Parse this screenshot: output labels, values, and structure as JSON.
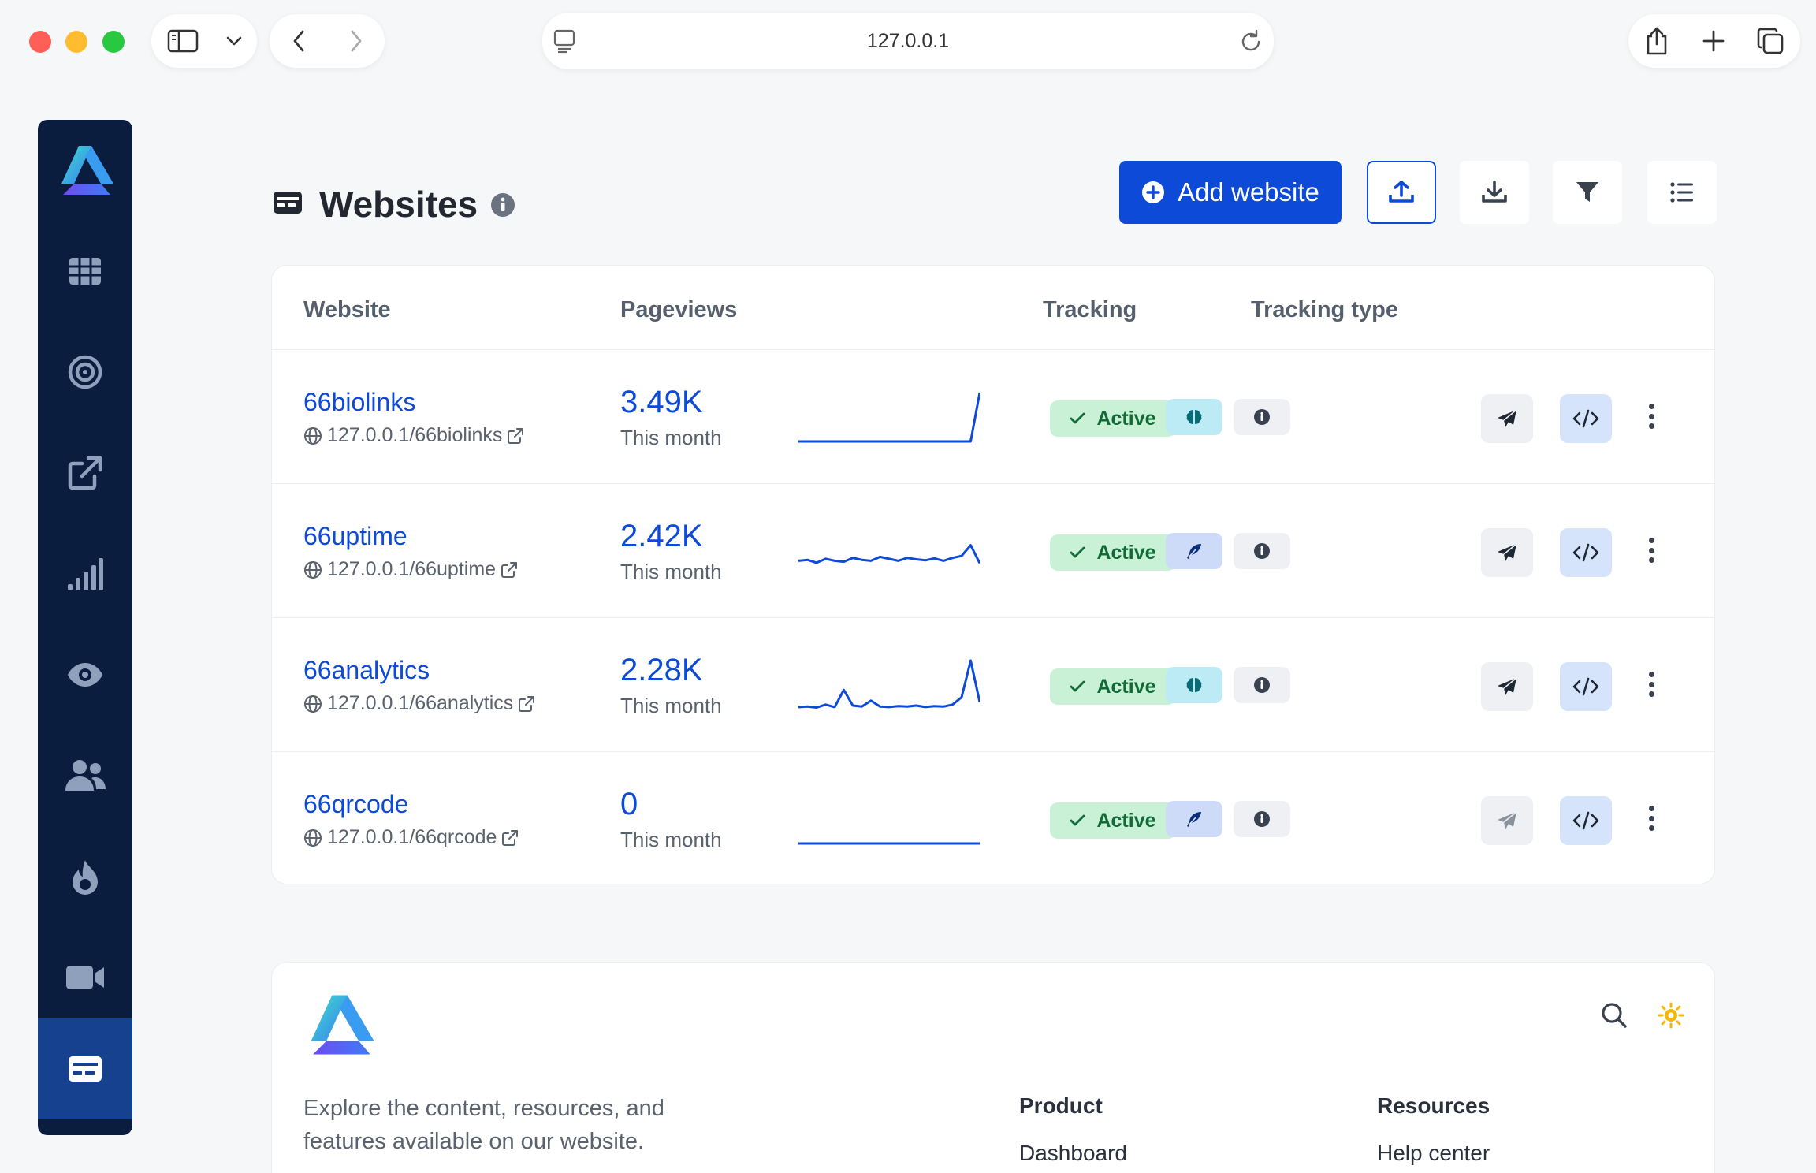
{
  "browser": {
    "url": "127.0.0.1"
  },
  "page": {
    "title": "Websites",
    "add_button": "Add website"
  },
  "table": {
    "headers": [
      "Website",
      "Pageviews",
      "Tracking",
      "Tracking type"
    ],
    "rows": [
      {
        "name": "66biolinks",
        "url": "127.0.0.1/66biolinks",
        "pageviews": "3.49K",
        "period": "This month",
        "status": "Active",
        "tracking_icon": "brain-icon",
        "spark": [
          0,
          0,
          0,
          0,
          0,
          0,
          0,
          0,
          0,
          0,
          0,
          0,
          0,
          0,
          0,
          0,
          0,
          0,
          0,
          0,
          1
        ]
      },
      {
        "name": "66uptime",
        "url": "127.0.0.1/66uptime",
        "pageviews": "2.42K",
        "period": "This month",
        "status": "Active",
        "tracking_icon": "feather-icon",
        "spark": [
          0.3,
          0.32,
          0.26,
          0.34,
          0.3,
          0.28,
          0.36,
          0.32,
          0.3,
          0.38,
          0.34,
          0.3,
          0.36,
          0.33,
          0.31,
          0.35,
          0.3,
          0.36,
          0.4,
          0.62,
          0.25
        ]
      },
      {
        "name": "66analytics",
        "url": "127.0.0.1/66analytics",
        "pageviews": "2.28K",
        "period": "This month",
        "status": "Active",
        "tracking_icon": "brain-icon",
        "spark": [
          0.05,
          0.06,
          0.04,
          0.1,
          0.05,
          0.4,
          0.08,
          0.06,
          0.18,
          0.06,
          0.05,
          0.07,
          0.06,
          0.08,
          0.05,
          0.07,
          0.06,
          0.1,
          0.25,
          1.0,
          0.15
        ]
      },
      {
        "name": "66qrcode",
        "url": "127.0.0.1/66qrcode",
        "pageviews": "0",
        "period": "This month",
        "status": "Active",
        "tracking_icon": "feather-icon",
        "spark": [
          0,
          0,
          0,
          0,
          0,
          0,
          0,
          0,
          0,
          0,
          0,
          0,
          0,
          0,
          0,
          0,
          0,
          0,
          0,
          0,
          0
        ]
      }
    ]
  },
  "footer": {
    "description": "Explore the content, resources, and features available on our website.",
    "col1_title": "Product",
    "col1_link": "Dashboard",
    "col2_title": "Resources",
    "col2_link": "Help center"
  },
  "colors": {
    "accent": "#0d4ad8",
    "sidebar": "#0b1d3f",
    "sidebar_active": "#16418f",
    "active_badge_bg": "#c9f1d6",
    "active_badge_text": "#136a37",
    "code_btn_bg": "#d6e4fb"
  }
}
